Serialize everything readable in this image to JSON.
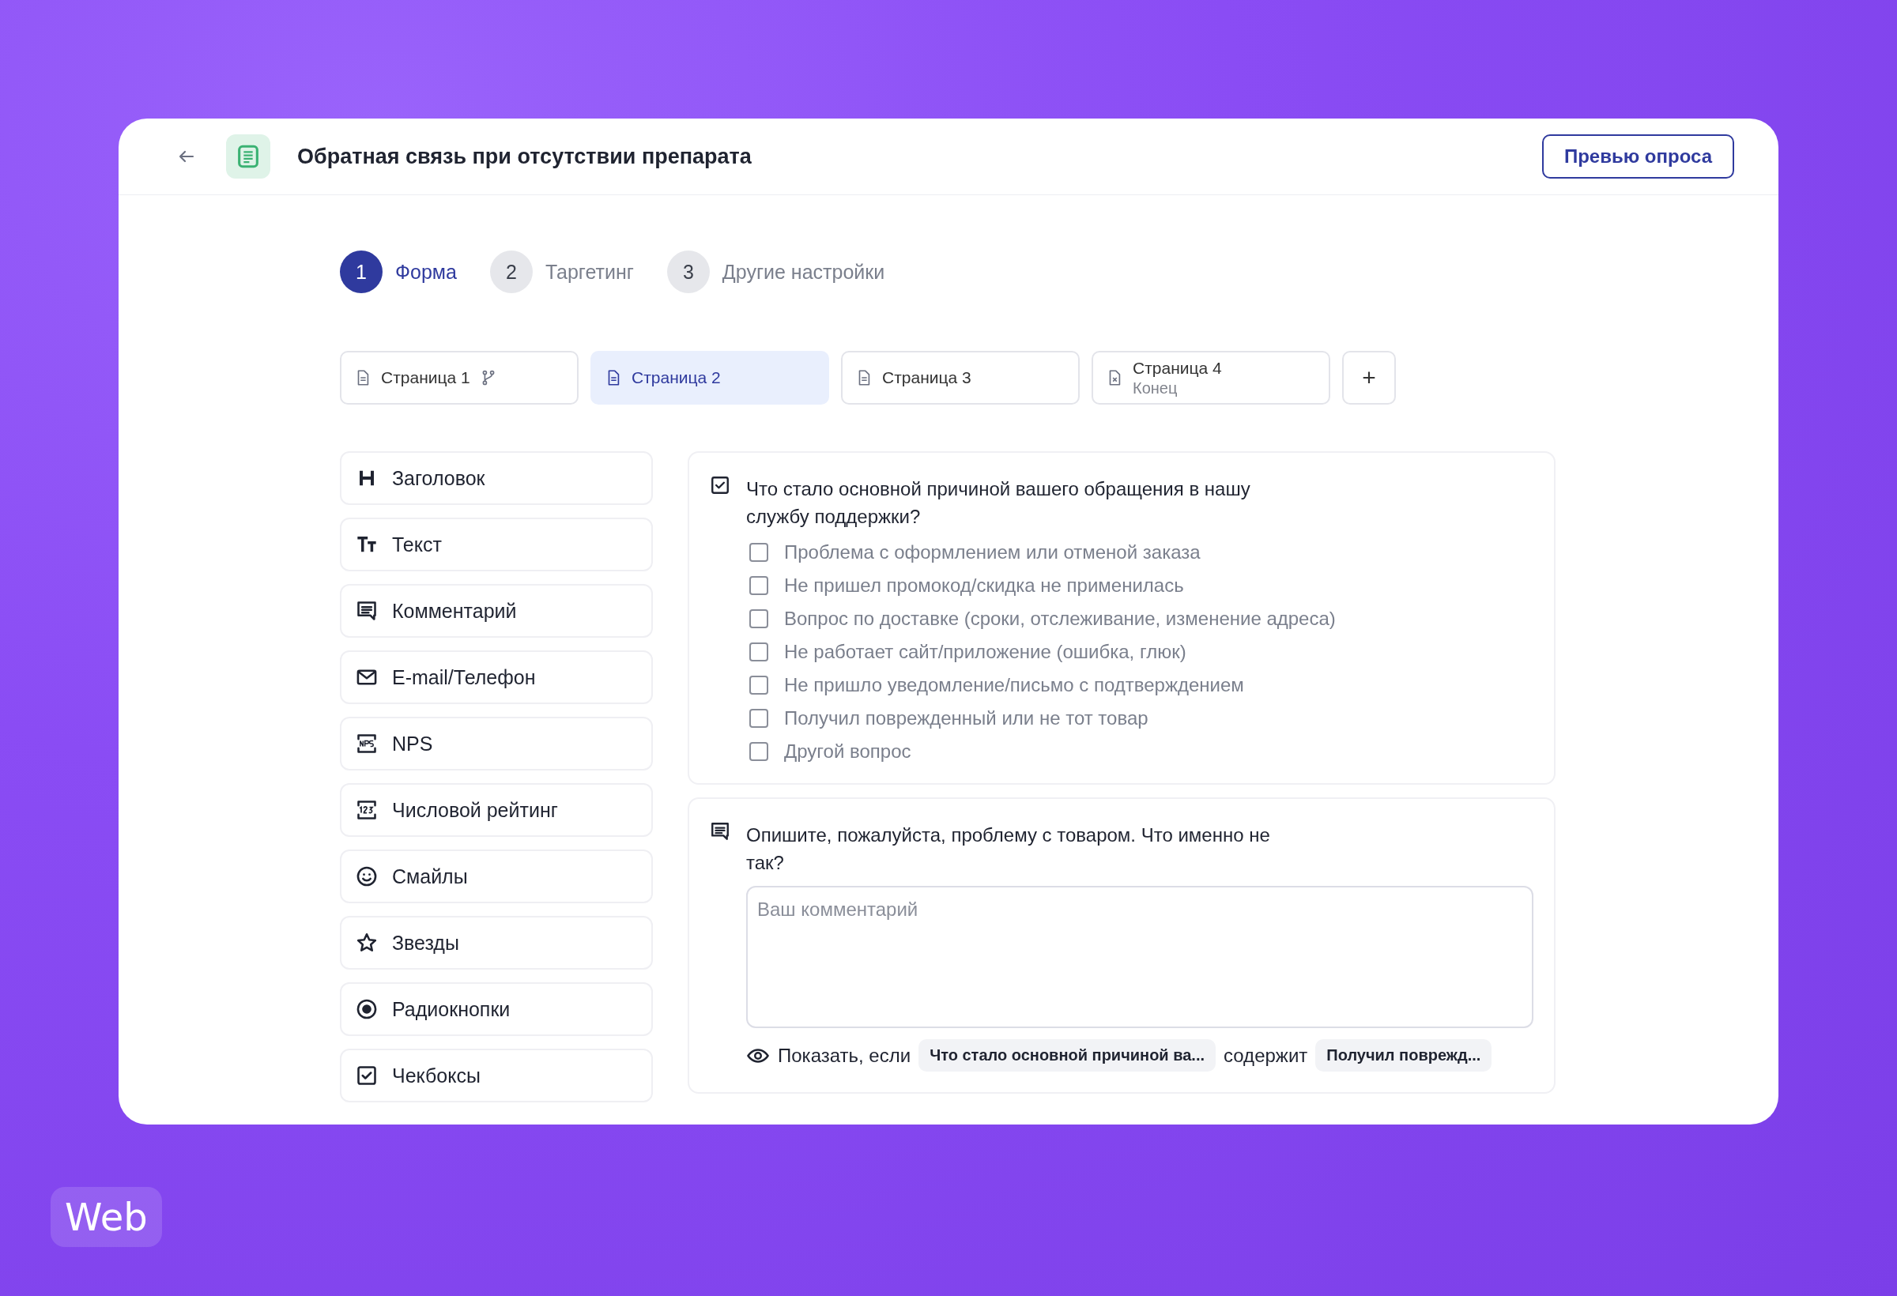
{
  "header": {
    "title": "Обратная связь при отсутствии препарата",
    "preview_button": "Превью опроса"
  },
  "steps": [
    {
      "number": "1",
      "label": "Форма",
      "selected": true
    },
    {
      "number": "2",
      "label": "Таргетинг",
      "selected": false
    },
    {
      "number": "3",
      "label": "Другие настройки",
      "selected": false
    }
  ],
  "pages": [
    {
      "label": "Страница 1",
      "kind": "page",
      "branching": true,
      "selected": false
    },
    {
      "label": "Страница 2",
      "kind": "page",
      "branching": false,
      "selected": true
    },
    {
      "label": "Страница 3",
      "kind": "page",
      "branching": false,
      "selected": false
    },
    {
      "label": "Страница 4",
      "subtitle": "Конец",
      "kind": "end",
      "branching": false,
      "selected": false
    }
  ],
  "add_page_button": "+",
  "palette": [
    {
      "label": "Заголовок",
      "kind": "heading"
    },
    {
      "label": "Текст",
      "kind": "text"
    },
    {
      "label": "Комментарий",
      "kind": "comment"
    },
    {
      "label": "E-mail/Телефон",
      "kind": "email"
    },
    {
      "label": "NPS",
      "kind": "nps"
    },
    {
      "label": "Числовой рейтинг",
      "kind": "number"
    },
    {
      "label": "Смайлы",
      "kind": "smile"
    },
    {
      "label": "Звезды",
      "kind": "star"
    },
    {
      "label": "Радиокнопки",
      "kind": "radio"
    },
    {
      "label": "Чекбоксы",
      "kind": "checkbox"
    }
  ],
  "questions": [
    {
      "kind": "checkbox",
      "text": "Что стало основной причиной вашего обращения в нашу службу поддержки?",
      "options": [
        {
          "label": "Проблема с оформлением или отменой заказа",
          "checked": false
        },
        {
          "label": "Не пришел промокод/скидка не применилась",
          "checked": false
        },
        {
          "label": "Вопрос по доставке (сроки, отслеживание, изменение адреса)",
          "checked": false
        },
        {
          "label": "Не работает сайт/приложение (ошибка, глюк)",
          "checked": false
        },
        {
          "label": "Не пришло уведомление/письмо с подтверждением",
          "checked": false
        },
        {
          "label": "Получил поврежденный или не тот товар",
          "checked": false
        },
        {
          "label": "Другой вопрос",
          "checked": false
        }
      ]
    },
    {
      "kind": "comment",
      "text": "Опишите, пожалуйста, проблему с товаром. Что именно не так?",
      "placeholder": "Ваш комментарий",
      "condition": {
        "prefix": "Показать, если",
        "question": "Что стало основной причиной ва...",
        "operator": "содержит",
        "value": "Получил поврежд..."
      }
    }
  ],
  "platform_badge": "Web"
}
